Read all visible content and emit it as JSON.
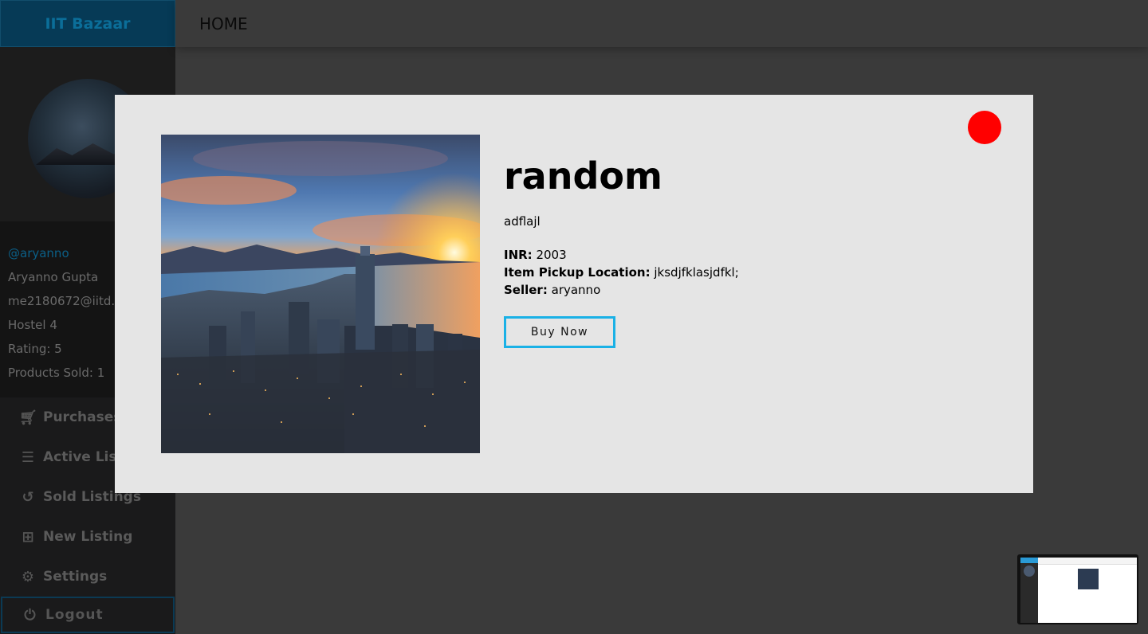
{
  "sidebar": {
    "brand": "IIT Bazaar",
    "profile": {
      "username": "@aryanno",
      "name": "Aryanno Gupta",
      "email": "me2180672@iitd.a",
      "hostel": "Hostel 4",
      "rating": "Rating: 5",
      "products_sold": "Products Sold: 1"
    },
    "menu": [
      {
        "label": "Purchases",
        "icon": "cart-icon"
      },
      {
        "label": "Active Listi",
        "icon": "list-icon"
      },
      {
        "label": "Sold Listings",
        "icon": "history-icon"
      },
      {
        "label": "New Listing",
        "icon": "plus-square-icon"
      },
      {
        "label": "Settings",
        "icon": "gear-icon"
      },
      {
        "label": "Logout",
        "icon": "power-icon"
      }
    ]
  },
  "topbar": {
    "home_label": "HOME"
  },
  "modal": {
    "title": "random",
    "description": "adflajl",
    "price_label": "INR:",
    "price_value": "2003",
    "pickup_label": "Item Pickup Location:",
    "pickup_value": "jksdjfklasjdfkl;",
    "seller_label": "Seller:",
    "seller_value": "aryanno",
    "buy_label": "Buy Now",
    "close_color": "#ff0000",
    "accent_color": "#1ab1e6"
  }
}
